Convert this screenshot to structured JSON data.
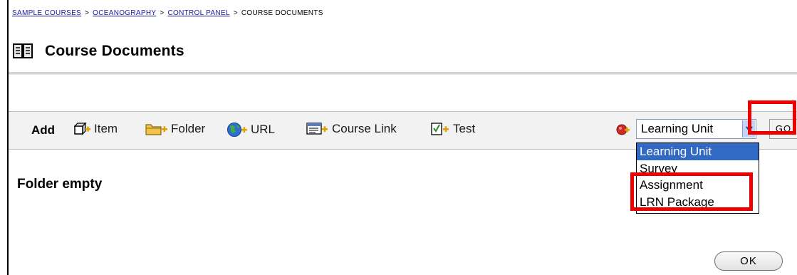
{
  "breadcrumb": {
    "items": [
      "SAMPLE COURSES",
      "OCEANOGRAPHY",
      "CONTROL PANEL"
    ],
    "separator": ">",
    "current": "COURSE DOCUMENTS"
  },
  "page": {
    "title": "Course Documents",
    "empty_message": "Folder empty"
  },
  "actionbar": {
    "add_label": "Add",
    "tools": [
      {
        "label": "Item",
        "icon": "item-icon"
      },
      {
        "label": "Folder",
        "icon": "folder-icon"
      },
      {
        "label": "URL",
        "icon": "globe-icon"
      },
      {
        "label": "Course Link",
        "icon": "course-link-icon"
      },
      {
        "label": "Test",
        "icon": "test-icon"
      }
    ],
    "select": {
      "value": "Learning Unit",
      "options": [
        "Learning Unit",
        "Survey",
        "Assignment",
        "LRN Package"
      ]
    },
    "go_label": "GO"
  },
  "footer": {
    "ok_label": "OK"
  },
  "colors": {
    "highlight": "#ee0000",
    "link": "#1a1aa0",
    "selected_option": "#316ac5"
  }
}
